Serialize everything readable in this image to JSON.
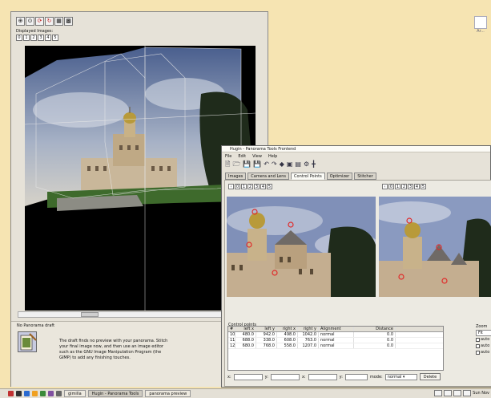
{
  "desktop": {
    "icon_label": "Ar..."
  },
  "preview": {
    "toolbar": {
      "buttons": [
        "zoom-in-icon",
        "zoom-fit-icon",
        "redraw-icon",
        "refresh-icon",
        "grid-icon",
        "grid2-icon"
      ]
    },
    "displayed_images_label": "Displayed Images:",
    "image_numbers": [
      "0",
      "1",
      "2",
      "3",
      "4",
      "5"
    ],
    "info": {
      "title": "No Panorama draft",
      "text": "The draft finds no preview with your panorama. Stitch your final image now, and then use an image editor such as the GNU Image Manipulation Program (the GIMP) to add any finishing touches."
    }
  },
  "hugin": {
    "title": "Hugin - Panorama Tools Frontend",
    "menu": [
      "File",
      "Edit",
      "View",
      "Help"
    ],
    "tabs": [
      "Images",
      "Camera and Lens",
      "Control Points",
      "Optimizer",
      "Stitcher"
    ],
    "active_tab": "Control Points",
    "left_nav": [
      "0",
      "1",
      "2",
      "3",
      "4",
      "5"
    ],
    "right_nav": [
      "0",
      "1",
      "2",
      "3",
      "4",
      "5"
    ],
    "control_points_label": "Control points",
    "table": {
      "headers": [
        "#",
        "left x",
        "left y",
        "right x",
        "right y",
        "Alignment",
        "Distance"
      ],
      "rows": [
        [
          "10",
          "480.0",
          "942.0",
          "498.0",
          "1042.0",
          "normal",
          "0.0"
        ],
        [
          "11",
          "688.0",
          "338.0",
          "608.0",
          "763.0",
          "normal",
          "0.0"
        ],
        [
          "12",
          "680.0",
          "768.0",
          "558.0",
          "1207.0",
          "normal",
          "0.0"
        ]
      ]
    },
    "fields": {
      "x_label": "x:",
      "y_label": "y:",
      "mode_label": "mode:",
      "mode_value": "normal",
      "delete_label": "Delete"
    },
    "zoom": {
      "label": "Zoom",
      "value": "Fit",
      "options": [
        "auto",
        "auto",
        "auto"
      ]
    }
  },
  "taskbar": {
    "tasks": [
      {
        "label": "gimilla",
        "active": false
      },
      {
        "label": "Hugin - Panorama Tools",
        "active": true
      },
      {
        "label": "panorama preview",
        "active": false
      }
    ],
    "clock": "Sun Nov"
  }
}
